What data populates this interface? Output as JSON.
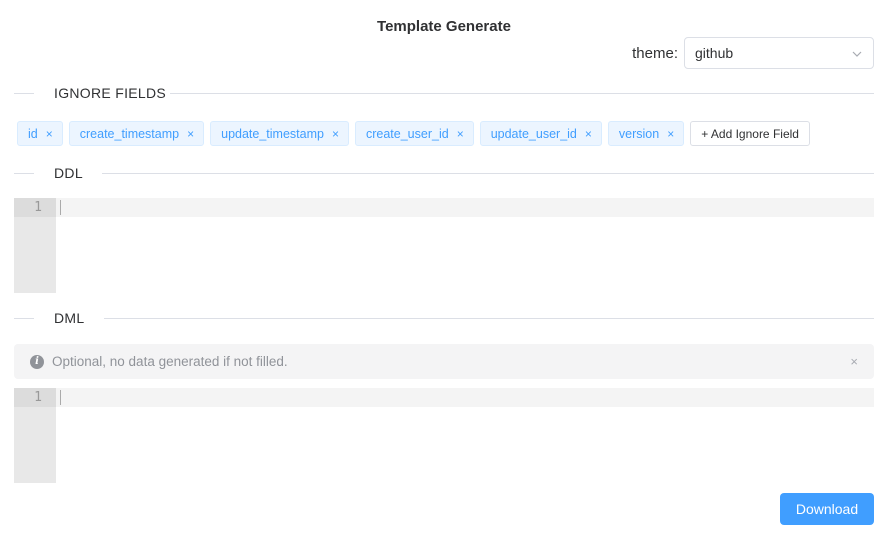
{
  "title": "Template Generate",
  "theme": {
    "label": "theme:",
    "value": "github",
    "icon": "chevron-down-icon"
  },
  "sections": {
    "ignore_fields": "IGNORE FIELDS",
    "ddl": "DDL",
    "dml": "DML"
  },
  "ignore_fields": {
    "tags": [
      "id",
      "create_timestamp",
      "update_timestamp",
      "create_user_id",
      "update_user_id",
      "version"
    ],
    "remove_icon": "×",
    "add_label": "+ Add Ignore Field"
  },
  "ddl_editor": {
    "line_number": "1"
  },
  "dml_alert": {
    "icon": "info-icon",
    "icon_glyph": "i",
    "message": "Optional, no data generated if not filled.",
    "close_glyph": "×"
  },
  "dml_editor": {
    "line_number": "1"
  },
  "download_label": "Download",
  "colors": {
    "primary": "#409eff",
    "tag_bg": "#ecf5ff",
    "alert_bg": "#f4f4f5"
  }
}
